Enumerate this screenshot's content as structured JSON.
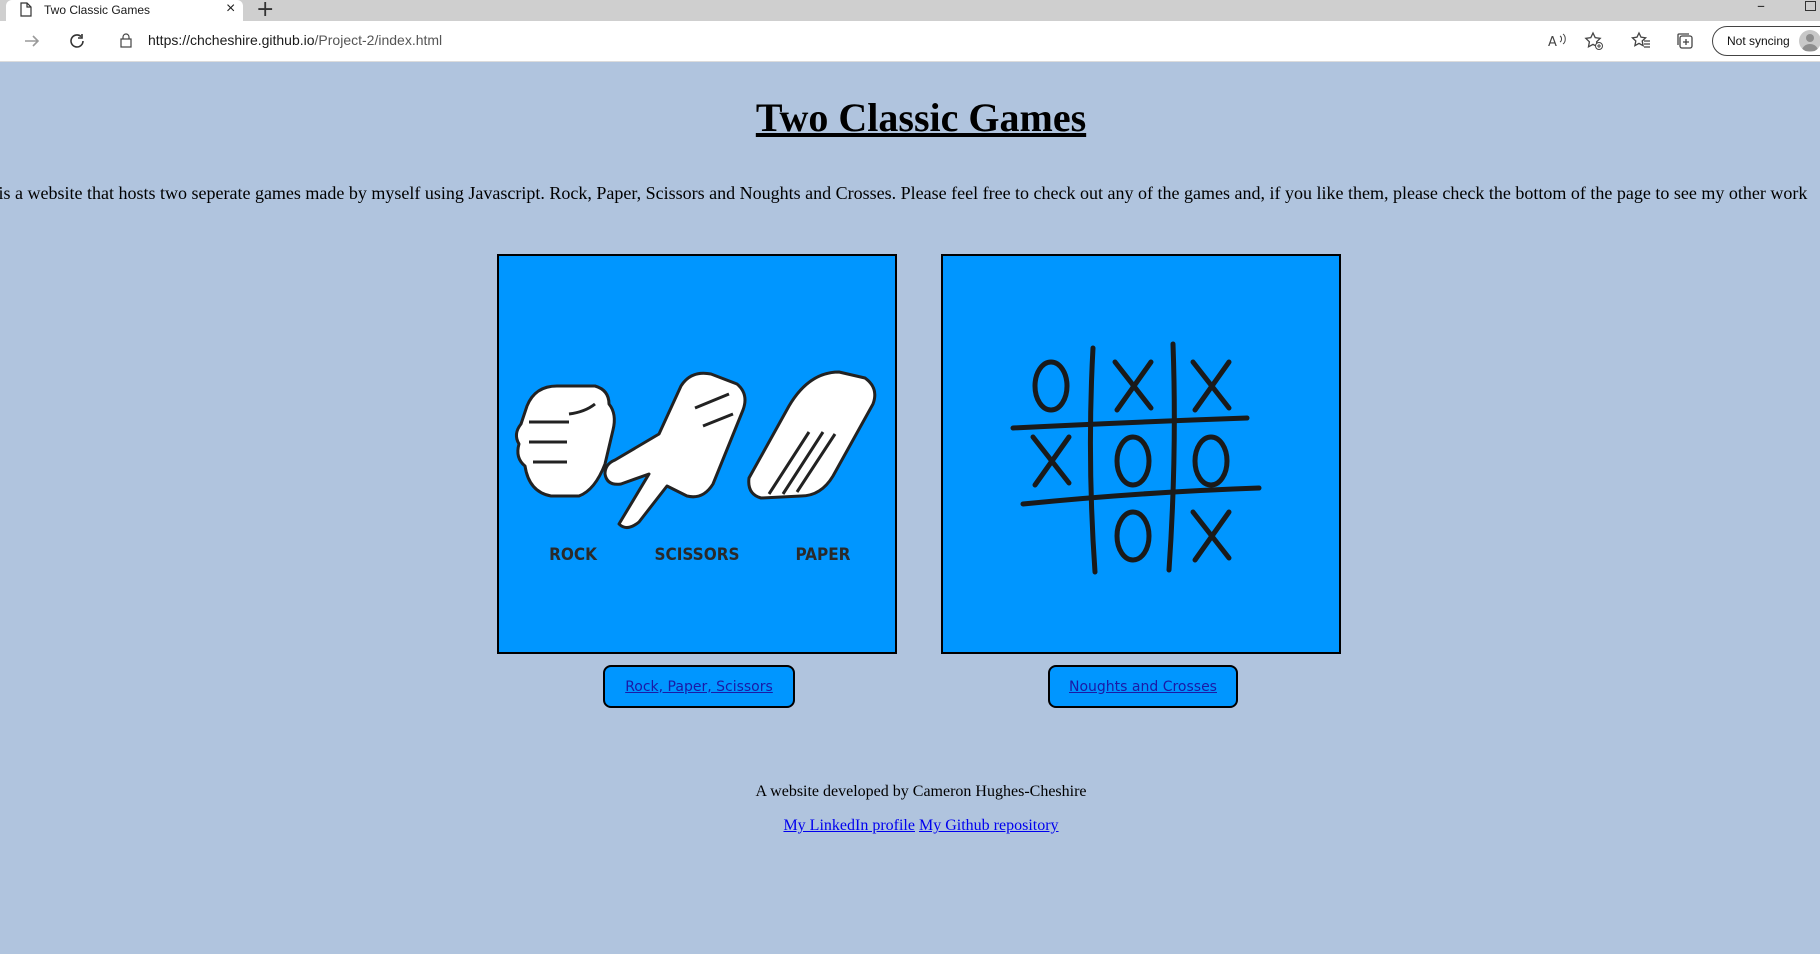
{
  "browser": {
    "tab_title": "Two Classic Games",
    "url_host": "https://chcheshire.github.io",
    "url_path": "/Project-2/index.html",
    "sync_label": "Not syncing"
  },
  "page": {
    "title": "Two Classic Games",
    "intro": "is is a website that hosts two seperate games made by myself using Javascript. Rock, Paper, Scissors and Noughts and Crosses. Please feel free to check out any of the games and, if you like them, please check the bottom of the page to see my other work"
  },
  "games": [
    {
      "button_label": "Rock, Paper, Scissors",
      "image_labels": [
        "ROCK",
        "SCISSORS",
        "PAPER"
      ]
    },
    {
      "button_label": "Noughts and Crosses",
      "board": [
        [
          "O",
          "X",
          "X"
        ],
        [
          "X",
          "O",
          "O"
        ],
        [
          "",
          "O",
          "X"
        ]
      ]
    }
  ],
  "footer": {
    "credit": "A website developed by Cameron Hughes-Cheshire",
    "linkedin_label": "My LinkedIn profile",
    "github_label": "My Github repository"
  },
  "colors": {
    "page_background": "#b0c4de",
    "card_background": "#0096ff"
  }
}
